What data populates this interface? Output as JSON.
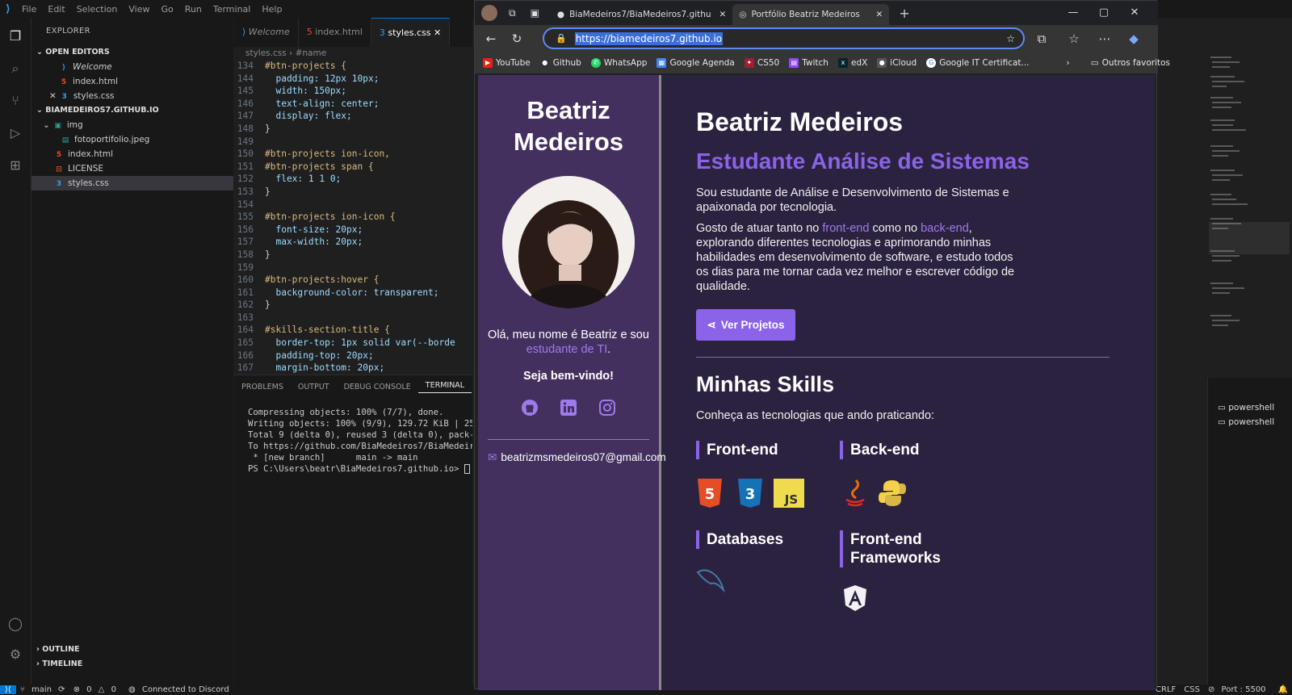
{
  "vscode": {
    "menu": [
      "File",
      "Edit",
      "Selection",
      "View",
      "Go",
      "Run",
      "Terminal",
      "Help"
    ],
    "explorer": {
      "title": "EXPLORER",
      "open_editors_label": "OPEN EDITORS",
      "open_editors": [
        "Welcome",
        "index.html",
        "styles.css"
      ],
      "repo_label": "BIAMEDEIROS7.GITHUB.IO",
      "files": [
        "img",
        "fotoportifolio.jpeg",
        "index.html",
        "LICENSE",
        "styles.css"
      ],
      "outline_label": "OUTLINE",
      "timeline_label": "TIMELINE"
    },
    "tabs": [
      "Welcome",
      "index.html",
      "styles.css"
    ],
    "breadcrumb": [
      "styles.css",
      "#name"
    ],
    "code_lines": [
      {
        "n": "134",
        "t": "#btn-projects {"
      },
      {
        "n": "144",
        "t": "  padding: 12px 10px;"
      },
      {
        "n": "145",
        "t": "  width: 150px;"
      },
      {
        "n": "146",
        "t": "  text-align: center;"
      },
      {
        "n": "147",
        "t": "  display: flex;"
      },
      {
        "n": "148",
        "t": "}"
      },
      {
        "n": "149",
        "t": ""
      },
      {
        "n": "150",
        "t": "#btn-projects ion-icon,"
      },
      {
        "n": "151",
        "t": "#btn-projects span {"
      },
      {
        "n": "152",
        "t": "  flex: 1 1 0;"
      },
      {
        "n": "153",
        "t": "}"
      },
      {
        "n": "154",
        "t": ""
      },
      {
        "n": "155",
        "t": "#btn-projects ion-icon {"
      },
      {
        "n": "156",
        "t": "  font-size: 20px;"
      },
      {
        "n": "157",
        "t": "  max-width: 20px;"
      },
      {
        "n": "158",
        "t": "}"
      },
      {
        "n": "159",
        "t": ""
      },
      {
        "n": "160",
        "t": "#btn-projects:hover {"
      },
      {
        "n": "161",
        "t": "  background-color: transparent;"
      },
      {
        "n": "162",
        "t": "}"
      },
      {
        "n": "163",
        "t": ""
      },
      {
        "n": "164",
        "t": "#skills-section-title {"
      },
      {
        "n": "165",
        "t": "  border-top: 1px solid var(--borde"
      },
      {
        "n": "166",
        "t": "  padding-top: 20px;"
      },
      {
        "n": "167",
        "t": "  margin-bottom: 20px;"
      }
    ],
    "panel_tabs": [
      "PROBLEMS",
      "OUTPUT",
      "DEBUG CONSOLE",
      "TERMINAL",
      "P"
    ],
    "terminal_lines": [
      "Compressing objects: 100% (7/7), done.",
      "Writing objects: 100% (9/9), 129.72 KiB | 25.94",
      "Total 9 (delta 0), reused 3 (delta 0), pack-reus",
      "To https://github.com/BiaMedeiros7/BiaMedeiros7.",
      " * [new branch]      main -> main",
      "PS C:\\Users\\beatr\\BiaMedeiros7.github.io> "
    ],
    "terminal_list": [
      "powershell",
      "powershell"
    ],
    "status": {
      "branch": "main",
      "errors": "0",
      "warnings": "0",
      "discord": "Connected to Discord",
      "eol": "CRLF",
      "lang": "CSS",
      "port": "Port : 5500"
    }
  },
  "browser": {
    "tabs": [
      {
        "title": "BiaMedeiros7/BiaMedeiros7.githu"
      },
      {
        "title": "Portfólio Beatriz Medeiros"
      }
    ],
    "url": "https://biamedeiros7.github.io",
    "bookmarks": [
      "YouTube",
      "Github",
      "WhatsApp",
      "Google Agenda",
      "CS50",
      "Twitch",
      "edX",
      "iCloud",
      "Google IT Certificat..."
    ],
    "other_favorites": "Outros favoritos"
  },
  "portfolio": {
    "sidebar": {
      "name_line1": "Beatriz",
      "name_line2": "Medeiros",
      "intro_prefix": "Olá, meu nome é Beatriz e sou",
      "intro_link": "estudante de TI",
      "intro_suffix": ".",
      "welcome": "Seja bem-vindo!",
      "email": "beatrizmsmedeiros07@gmail.com"
    },
    "main": {
      "name": "Beatriz Medeiros",
      "role": "Estudante Análise de Sistemas",
      "p1": "Sou estudante de Análise e Desenvolvimento de Sistemas e apaixonada por tecnologia.",
      "p2_a": "Gosto de atuar tanto no ",
      "p2_link1": "front-end",
      "p2_b": " como no ",
      "p2_link2": "back-end",
      "p2_c": ", explorando diferentes tecnologias e aprimorando minhas habilidades em desenvolvimento de software, e estudo todos os dias para me tornar cada vez melhor e escrever código de qualidade.",
      "button": "Ver Projetos",
      "skills_title": "Minhas Skills",
      "skills_sub": "Conheça as tecnologias que ando praticando:",
      "groups": [
        "Front-end",
        "Back-end",
        "Databases",
        "Front-end Frameworks"
      ]
    }
  }
}
